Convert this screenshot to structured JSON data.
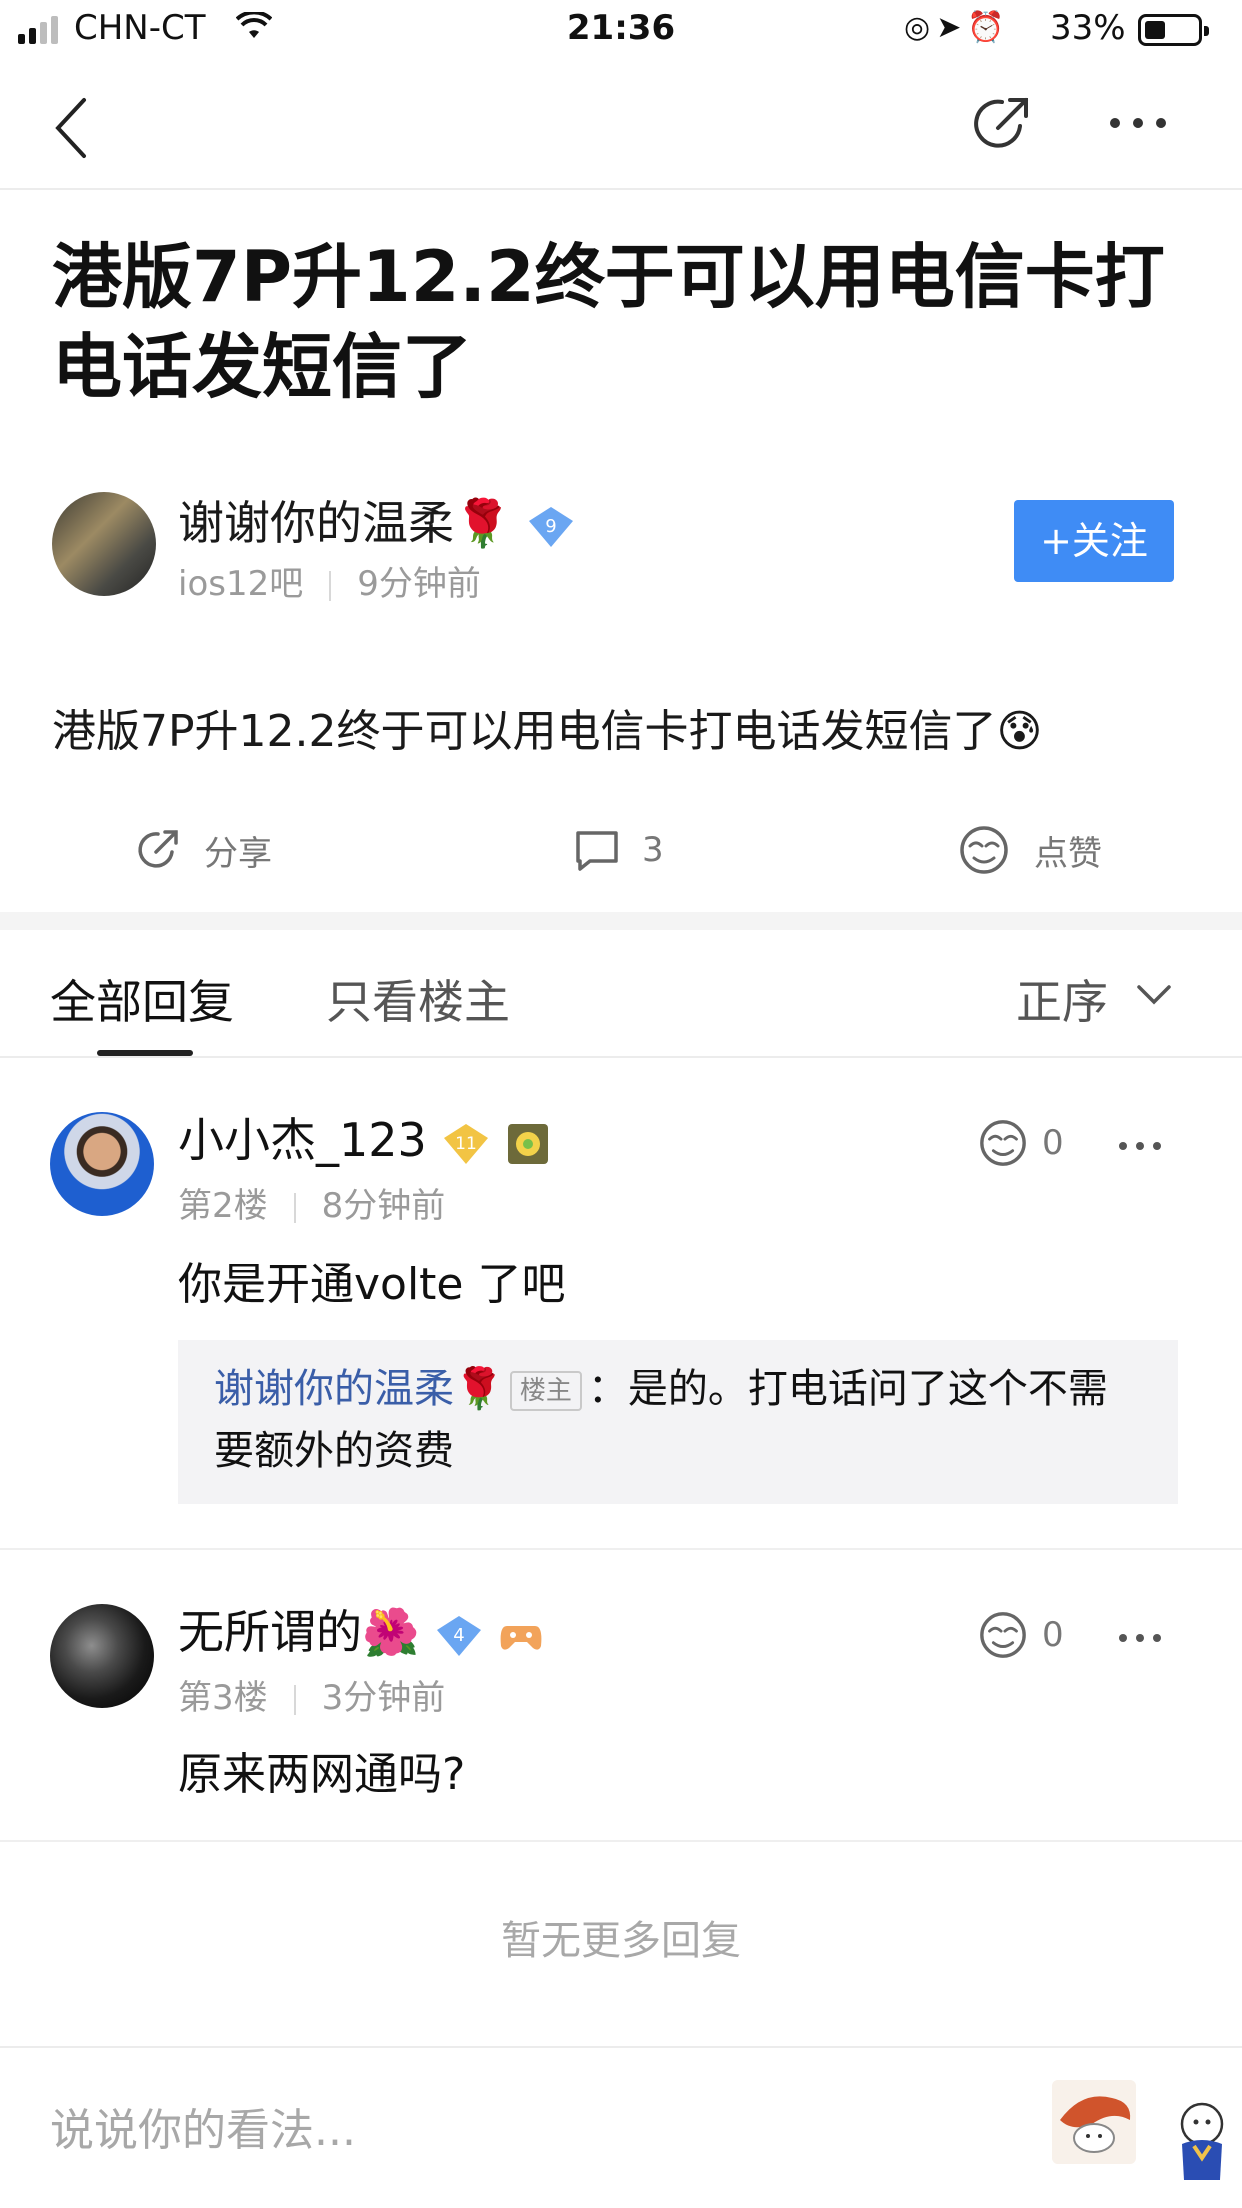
{
  "status_bar": {
    "carrier": "CHN-CT",
    "time": "21:36",
    "battery_percent": "33%",
    "battery_level": 0.33
  },
  "nav": {
    "back_icon": "chevron-left-icon",
    "share_icon": "share-icon",
    "more_icon": "more-horizontal-icon"
  },
  "post": {
    "title": "港版7P升12.2终于可以用电信卡打电话发短信了",
    "author": {
      "name": "谢谢你的温柔🌹",
      "level": "9",
      "forum": "ios12吧",
      "time": "9分钟前"
    },
    "follow_label": "+关注",
    "content": "港版7P升12.2终于可以用电信卡打电话发短信了😰",
    "actions": {
      "share_label": "分享",
      "comment_count": "3",
      "like_label": "点赞"
    }
  },
  "tabs": {
    "all_replies": "全部回复",
    "only_op": "只看楼主",
    "sort_label": "正序"
  },
  "replies": [
    {
      "name": "小小杰_123",
      "level": "11",
      "floor": "第2楼",
      "time": "8分钟前",
      "likes": "0",
      "text": "你是开通volte 了吧",
      "sub_reply": {
        "name": "谢谢你的温柔🌹",
        "tag": "楼主",
        "text": "：是的。打电话问了这个不需要额外的资费"
      }
    },
    {
      "name": "无所谓的🌺",
      "level": "4",
      "floor": "第3楼",
      "time": "3分钟前",
      "likes": "0",
      "text": "原来两网通吗?"
    }
  ],
  "footer": {
    "no_more": "暂无更多回复",
    "comment_placeholder": "说说你的看法..."
  },
  "colors": {
    "accent_blue": "#3f8cf5",
    "quote_name_blue": "#3a5ea8",
    "gray_text": "#9a9a9a"
  }
}
